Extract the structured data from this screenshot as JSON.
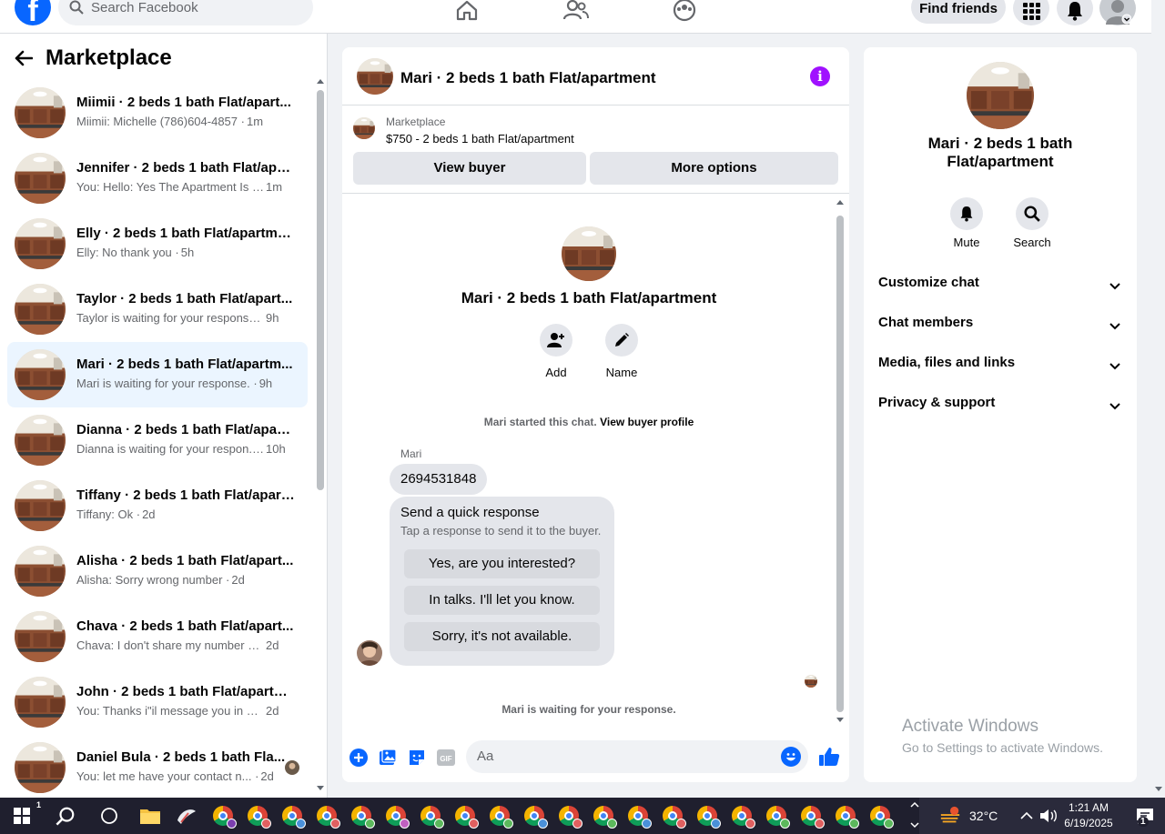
{
  "topbar": {
    "logo": "f",
    "search_placeholder": "Search Facebook",
    "find_friends": "Find friends",
    "icons": [
      "home-icon",
      "friends-icon",
      "groups-icon",
      "menu-grid-icon",
      "bell-icon",
      "profile-icon"
    ]
  },
  "sidebar": {
    "title": "Marketplace",
    "conversations": [
      {
        "title": "Miimii · 2 beds 1 bath Flat/apart...",
        "snippet": "Miimii: Michelle (786)604-4857 ·",
        "time": "1m"
      },
      {
        "title": "Jennifer · 2 beds 1 bath Flat/apa...",
        "snippet": "You: Hello: Yes The Apartment Is St... ·",
        "time": "1m"
      },
      {
        "title": "Elly · 2 beds 1 bath Flat/apartment",
        "snippet": "Elly: No thank you ·",
        "time": "5h"
      },
      {
        "title": "Taylor · 2 beds 1 bath Flat/apart...",
        "snippet": "Taylor is waiting for your response. ·",
        "time": "9h"
      },
      {
        "title": "Mari · 2 beds 1 bath Flat/apartm...",
        "snippet": "Mari is waiting for your response. ·",
        "time": "9h"
      },
      {
        "title": "Dianna · 2 beds 1 bath Flat/apart...",
        "snippet": "Dianna is waiting for your respon... ·",
        "time": "10h"
      },
      {
        "title": "Tiffany · 2 beds 1 bath Flat/apart...",
        "snippet": "Tiffany: Ok ·",
        "time": "2d"
      },
      {
        "title": "Alisha · 2 beds 1 bath Flat/apart...",
        "snippet": "Alisha: Sorry wrong number ·",
        "time": "2d"
      },
      {
        "title": "Chava · 2 beds 1 bath Flat/apart...",
        "snippet": "Chava: I don't share my number at ... ·",
        "time": "2d"
      },
      {
        "title": "John · 2 beds 1 bath Flat/apartm...",
        "snippet": "You: Thanks i\"il message you in a ... ·",
        "time": "2d"
      },
      {
        "title": "Daniel Bula · 2 beds 1 bath Fla...",
        "snippet": "You: let me have your contact n... ·",
        "time": "2d"
      }
    ]
  },
  "chat": {
    "header_title": "Mari · 2 beds 1 bath Flat/apartment",
    "marketplace_label": "Marketplace",
    "listing": "$750 - 2 beds 1 bath Flat/apartment",
    "view_buyer": "View buyer",
    "more_options": "More options",
    "center_name": "Mari · 2 beds 1 bath Flat/apartment",
    "add_label": "Add",
    "name_label": "Name",
    "started_text": "Mari started this chat.",
    "view_profile": "View buyer profile",
    "sender": "Mari",
    "message": "2694531848",
    "quick_title": "Send a quick response",
    "quick_sub": "Tap a response to send it to the buyer.",
    "quick_options": [
      "Yes, are you interested?",
      "In talks. I'll let you know.",
      "Sorry, it's not available."
    ],
    "waiting": "Mari is waiting for your response.",
    "composer_placeholder": "Aa",
    "gif": "GIF"
  },
  "right_panel": {
    "name": "Mari · 2 beds 1 bath Flat/apartment",
    "mute": "Mute",
    "search": "Search",
    "sections": [
      "Customize chat",
      "Chat members",
      "Media, files and links",
      "Privacy & support"
    ]
  },
  "watermark": {
    "line1": "Activate Windows",
    "line2": "Go to Settings to activate Windows."
  },
  "taskbar": {
    "temperature": "32°C",
    "time": "1:21 AM",
    "date": "6/19/2025",
    "notifications": "1",
    "weather_badge": "1",
    "chrome_badge_colors": [
      "#7b3fb0",
      "#e06060",
      "#4a90d9",
      "#e06060",
      "#5cb85c",
      "#c060c0",
      "#5cb85c",
      "#e06060",
      "#5cb85c",
      "#4a90d9",
      "#e06060",
      "#5cb85c",
      "#4a90d9",
      "#e06060",
      "#4a90d9",
      "#e06060",
      "#5cb85c",
      "#e06060",
      "#5cb85c",
      "#5cb85c"
    ]
  },
  "colors": {
    "accent": "#0866ff",
    "info": "#a011ff",
    "active_row": "#ebf5ff"
  }
}
